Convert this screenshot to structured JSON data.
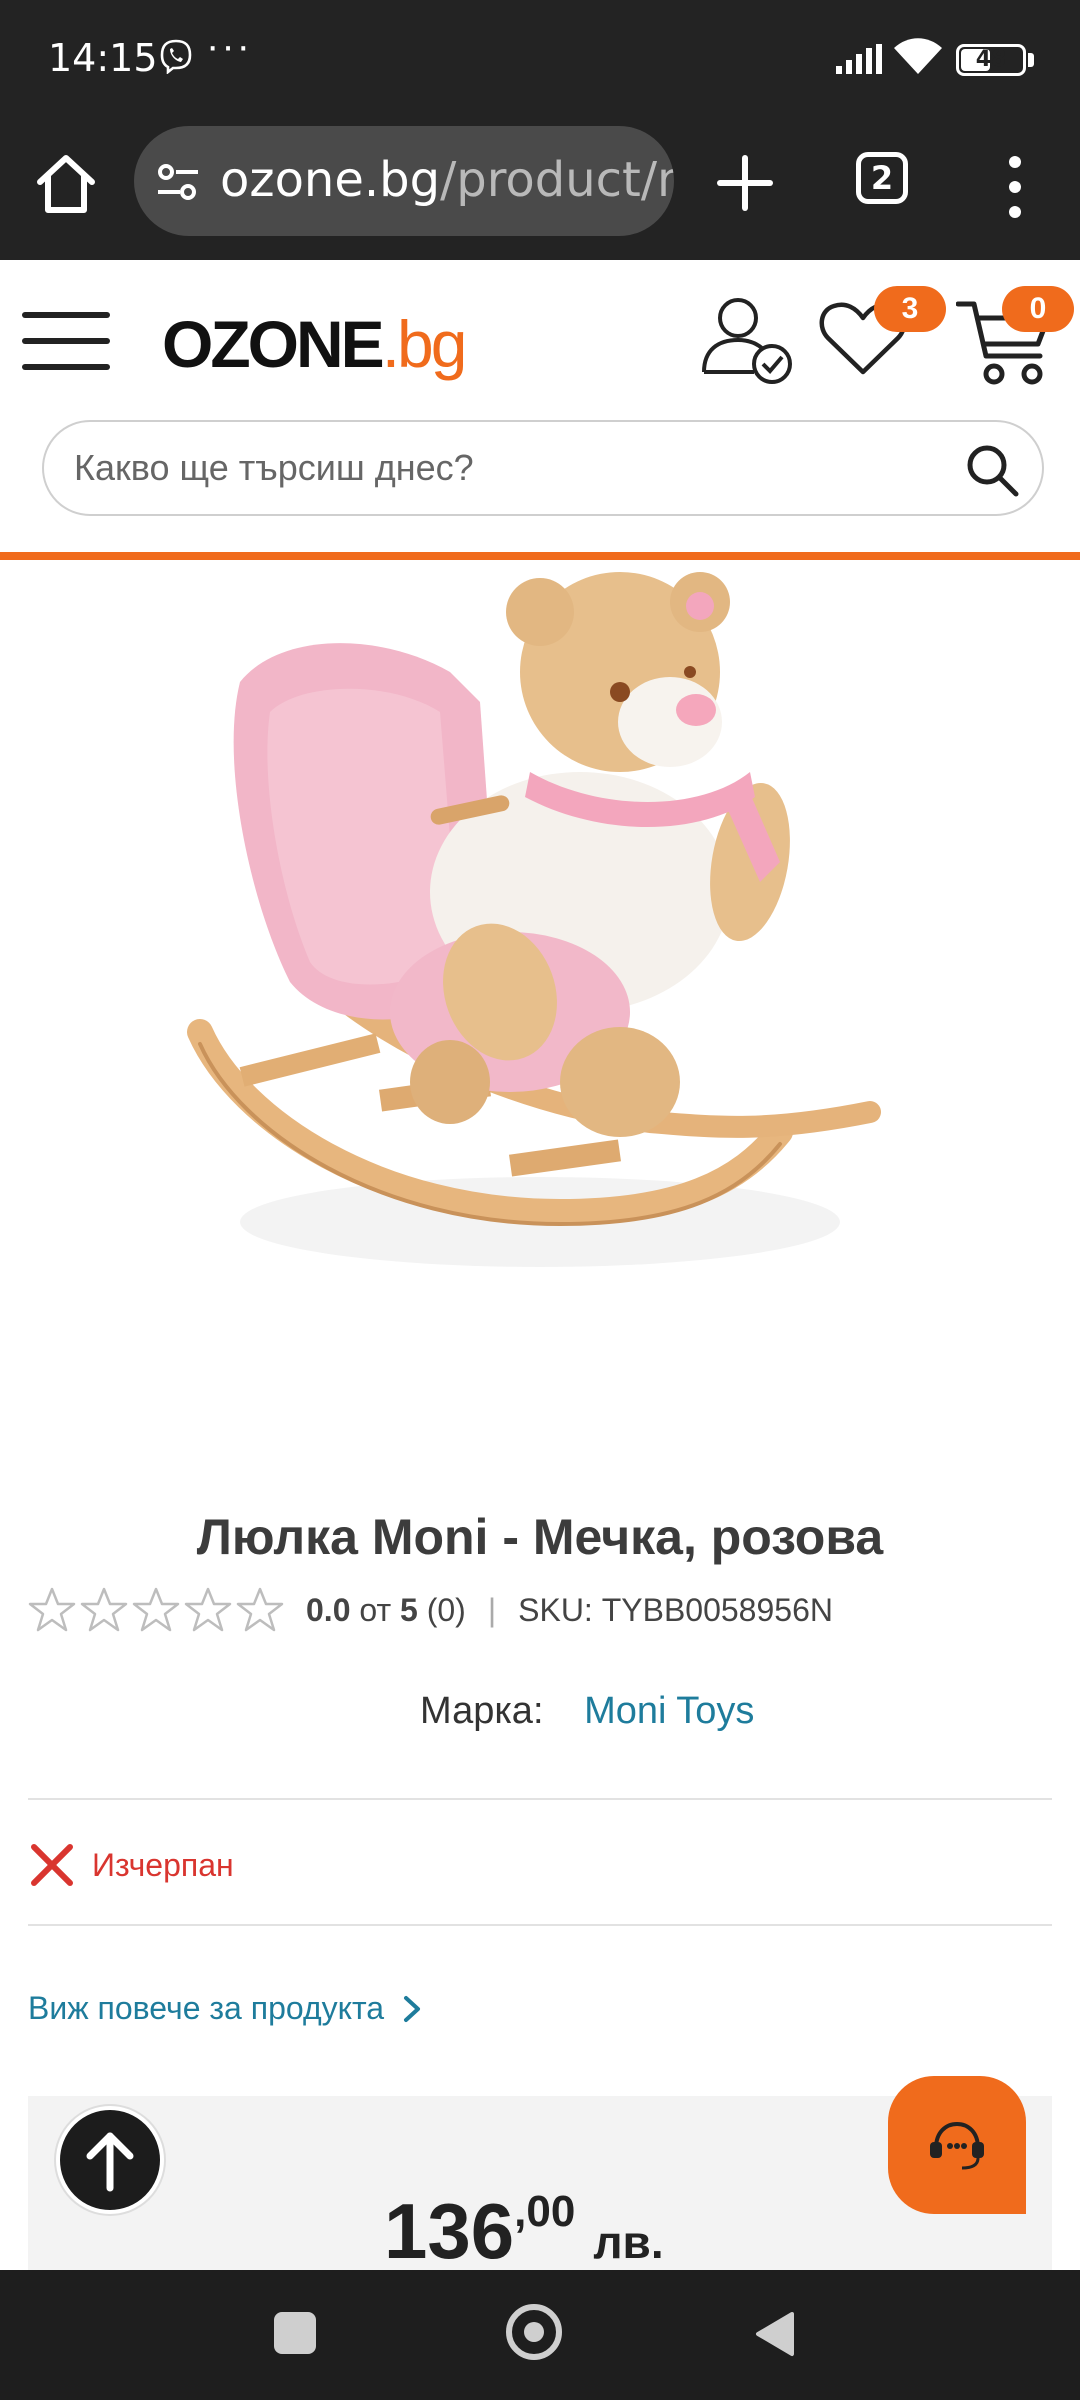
{
  "status_bar": {
    "time": "14:15",
    "dots": "···",
    "battery": "48",
    "battery_level": 0.48,
    "icons": [
      "viber-icon",
      "signal-icon",
      "wifi-icon",
      "battery-icon"
    ]
  },
  "browser": {
    "url_domain": "ozone.bg",
    "url_path": "/product/n",
    "tab_count": "2",
    "icons": [
      "home-icon",
      "tune-icon",
      "plus-icon",
      "more-vert-icon"
    ]
  },
  "site": {
    "logo_main": "OZONE",
    "logo_suffix": ".bg",
    "wishlist_count": "3",
    "cart_count": "0",
    "search_placeholder": "Какво ще търсиш днес?",
    "accent_color": "#f06b1c"
  },
  "product": {
    "title": "Люлка Moni - Мечка, розова",
    "rating_value": "0.0",
    "rating_of": "от",
    "rating_max": "5",
    "rating_count": "(0)",
    "rating_stars_filled": 0,
    "sku_label": "SKU:",
    "sku_value": "TYBB0058956N",
    "brand_label": "Марка:",
    "brand_value": "Moni Toys",
    "availability": "Изчерпан",
    "more_link": "Виж повече за продукта",
    "price_integer": "136",
    "price_decimal": ",00",
    "price_currency": "лв.",
    "link_color": "#1e7c9c",
    "out_of_stock_color": "#d9352f"
  }
}
